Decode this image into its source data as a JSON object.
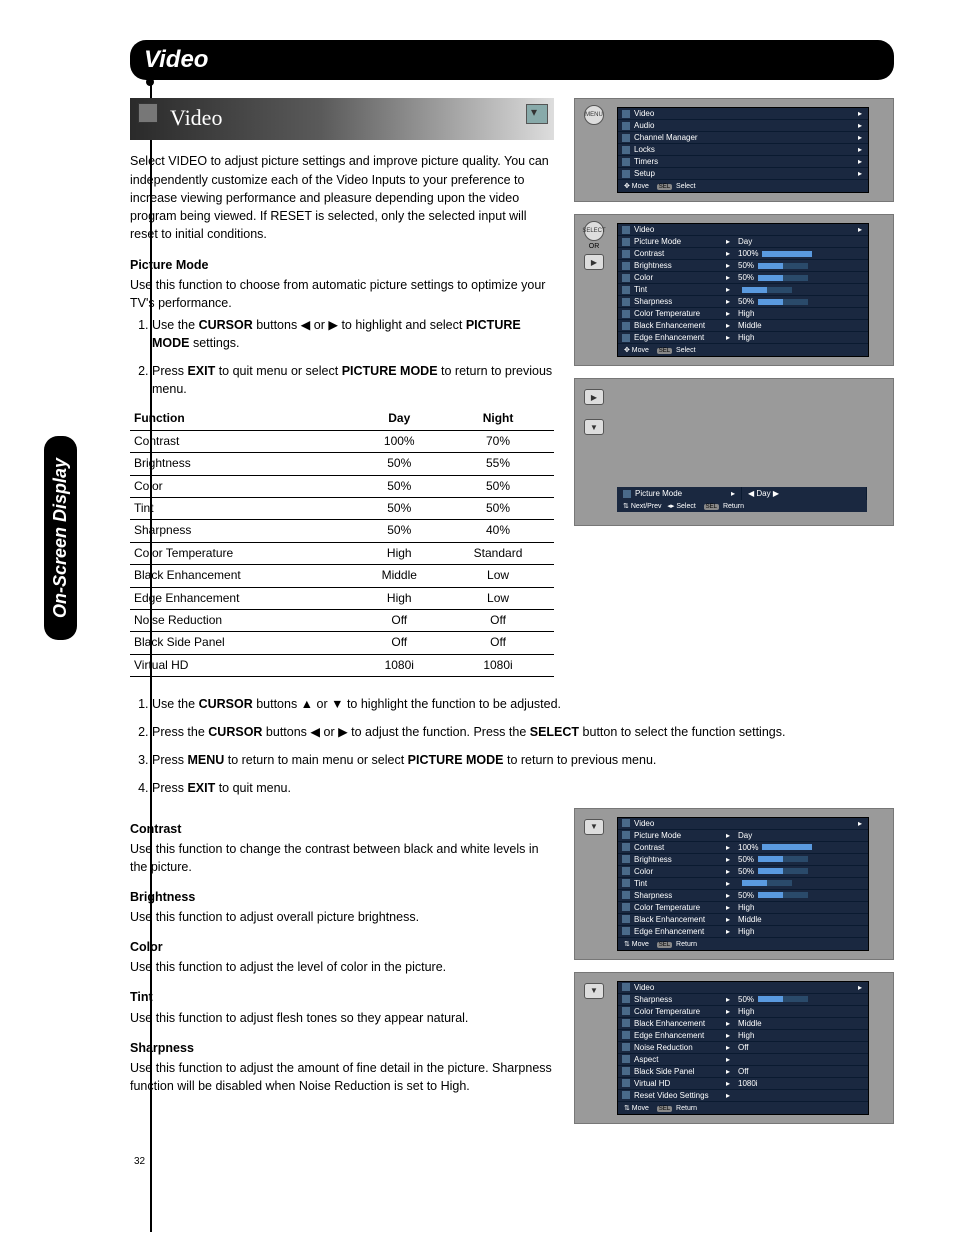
{
  "page_number": "32",
  "header": "Video",
  "side_tab": "On-Screen Display",
  "video_badge": "Video",
  "intro": "Select VIDEO to adjust picture settings and improve picture quality. You can independently customize each of the Video Inputs to your preference to increase viewing performance and pleasure depending upon the video program being viewed. If RESET is selected, only the selected input will reset to initial conditions.",
  "picture_mode": {
    "title": "Picture Mode",
    "intro": "Use this function to choose from automatic picture settings to optimize your TV's performance.",
    "step1_a": "Use the ",
    "step1_b": "CURSOR",
    "step1_c": " buttons ◀ or ▶ to highlight and select ",
    "step1_d": "PICTURE MODE",
    "step1_e": " settings.",
    "step2_a": "Press ",
    "step2_b": "EXIT",
    "step2_c": " to quit menu or select ",
    "step2_d": "PICTURE MODE",
    "step2_e": " to return to previous menu."
  },
  "table": {
    "h1": "Function",
    "h2": "Day",
    "h3": "Night",
    "rows": [
      {
        "f": "Contrast",
        "d": "100%",
        "n": "70%"
      },
      {
        "f": "Brightness",
        "d": "50%",
        "n": "55%"
      },
      {
        "f": "Color",
        "d": "50%",
        "n": "50%"
      },
      {
        "f": "Tint",
        "d": "50%",
        "n": "50%"
      },
      {
        "f": "Sharpness",
        "d": "50%",
        "n": "40%"
      },
      {
        "f": "Color Temperature",
        "d": "High",
        "n": "Standard"
      },
      {
        "f": "Black Enhancement",
        "d": "Middle",
        "n": "Low"
      },
      {
        "f": "Edge Enhancement",
        "d": "High",
        "n": "Low"
      },
      {
        "f": "Noise Reduction",
        "d": "Off",
        "n": "Off"
      },
      {
        "f": "Black Side Panel",
        "d": "Off",
        "n": "Off"
      },
      {
        "f": "Virtual HD",
        "d": "1080i",
        "n": "1080i"
      }
    ]
  },
  "wide_steps": {
    "s1_a": "Use the ",
    "s1_b": "CURSOR",
    "s1_c": " buttons ▲ or ▼ to highlight the function to be adjusted.",
    "s2_a": "Press the ",
    "s2_b": "CURSOR",
    "s2_c": " buttons ◀ or ▶ to adjust the function. Press the ",
    "s2_d": "SELECT",
    "s2_e": " button to select the function settings.",
    "s3_a": "Press ",
    "s3_b": "MENU",
    "s3_c": " to return to main menu or select ",
    "s3_d": "PICTURE MODE",
    "s3_e": " to return to previous menu.",
    "s4_a": "Press ",
    "s4_b": "EXIT",
    "s4_c": " to quit menu."
  },
  "defs": [
    {
      "t": "Contrast",
      "b": "Use this function to change the contrast between black and white levels in the picture."
    },
    {
      "t": "Brightness",
      "b": "Use this function to adjust overall picture brightness."
    },
    {
      "t": "Color",
      "b": "Use this function to adjust the level of color in the picture."
    },
    {
      "t": "Tint",
      "b": "Use this function to adjust flesh tones so they appear natural."
    },
    {
      "t": "Sharpness",
      "b": "Use this function to adjust the amount of fine detail in the picture. Sharpness function will be disabled when Noise Reduction is set to High."
    }
  ],
  "osd_top": {
    "label": "MENU",
    "items": [
      "Video",
      "Audio",
      "Channel Manager",
      "Locks",
      "Timers",
      "Setup"
    ],
    "hint_move": "Move",
    "hint_sel": "Select",
    "hint_sel_key": "SEL"
  },
  "osd_video": {
    "label_select": "SELECT",
    "label_or": "OR",
    "title": "Video",
    "rows": [
      {
        "l": "Picture Mode",
        "v": "Day"
      },
      {
        "l": "Contrast",
        "v": "100%",
        "p": 100
      },
      {
        "l": "Brightness",
        "v": "50%",
        "p": 50
      },
      {
        "l": "Color",
        "v": "50%",
        "p": 50
      },
      {
        "l": "Tint",
        "v": "",
        "p": 50
      },
      {
        "l": "Sharpness",
        "v": "50%",
        "p": 50
      },
      {
        "l": "Color Temperature",
        "v": "High"
      },
      {
        "l": "Black Enhancement",
        "v": "Middle"
      },
      {
        "l": "Edge Enhancement",
        "v": "High"
      }
    ],
    "hint_move": "Move",
    "hint_sel": "Select",
    "hint_sel_key": "SEL"
  },
  "osd_picmode": {
    "left": "Picture Mode",
    "right": "◀ Day ▶",
    "hint_np": "Next/Prev",
    "hint_sel": "Select",
    "hint_ret": "Return",
    "hint_ret_key": "SEL"
  },
  "osd_video2": {
    "title": "Video",
    "rows": [
      {
        "l": "Picture Mode",
        "v": "Day"
      },
      {
        "l": "Contrast",
        "v": "100%",
        "p": 100
      },
      {
        "l": "Brightness",
        "v": "50%",
        "p": 50
      },
      {
        "l": "Color",
        "v": "50%",
        "p": 50
      },
      {
        "l": "Tint",
        "v": "",
        "p": 50
      },
      {
        "l": "Sharpness",
        "v": "50%",
        "p": 50
      },
      {
        "l": "Color Temperature",
        "v": "High"
      },
      {
        "l": "Black Enhancement",
        "v": "Middle"
      },
      {
        "l": "Edge Enhancement",
        "v": "High"
      }
    ],
    "hint_move": "Move",
    "hint_ret": "Return",
    "hint_ret_key": "SEL"
  },
  "osd_video3": {
    "title": "Video",
    "rows": [
      {
        "l": "Sharpness",
        "v": "50%",
        "p": 50
      },
      {
        "l": "Color Temperature",
        "v": "High"
      },
      {
        "l": "Black Enhancement",
        "v": "Middle"
      },
      {
        "l": "Edge Enhancement",
        "v": "High"
      },
      {
        "l": "Noise Reduction",
        "v": "Off"
      },
      {
        "l": "Aspect",
        "v": ""
      },
      {
        "l": "Black Side Panel",
        "v": "Off"
      },
      {
        "l": "Virtual HD",
        "v": "1080i"
      },
      {
        "l": "Reset Video Settings",
        "v": ""
      }
    ],
    "hint_move": "Move",
    "hint_ret": "Return",
    "hint_ret_key": "SEL"
  }
}
